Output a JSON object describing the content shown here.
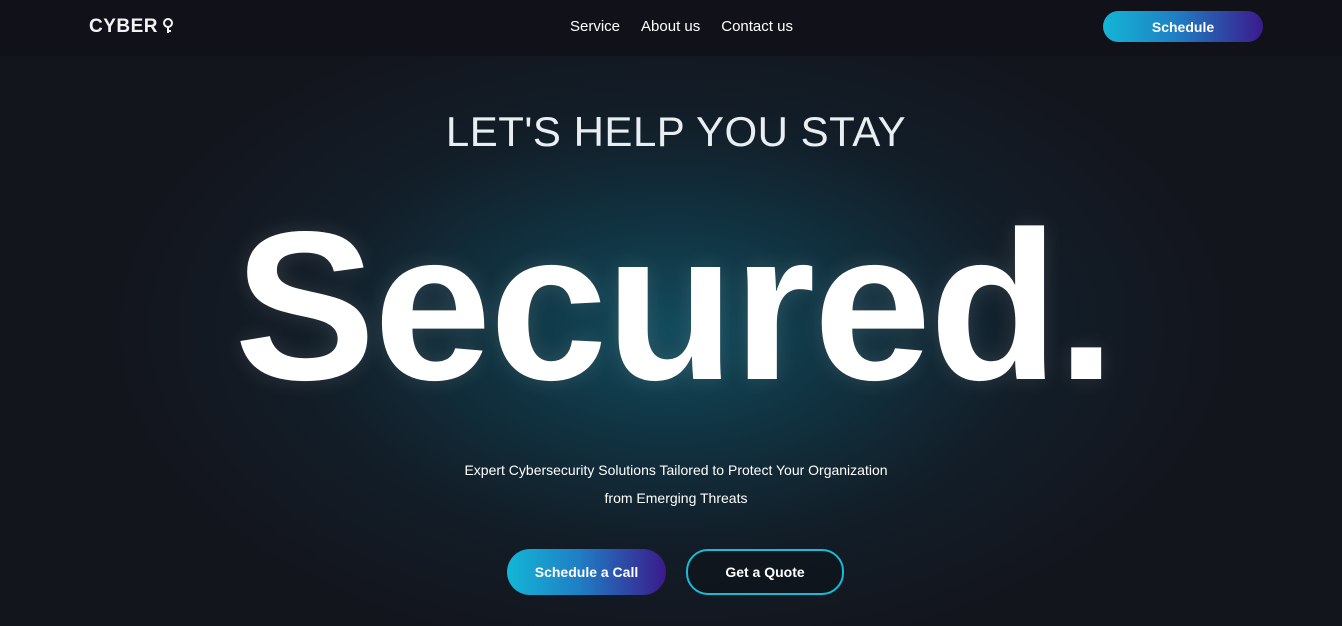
{
  "nav": {
    "logo_text": "CYBER",
    "logo_icon": "keyhole-icon",
    "links": [
      "Service",
      "About us",
      "Contact us"
    ],
    "cta_label": "Schedule"
  },
  "hero": {
    "kicker": "LET'S HELP YOU STAY",
    "title": "Secured.",
    "subtitle_line1": "Expert Cybersecurity Solutions Tailored to Protect Your Organization",
    "subtitle_line2": "from Emerging Threats",
    "primary_button": "Schedule a Call",
    "secondary_button": "Get a Quote"
  },
  "colors": {
    "background": "#13151d",
    "accent_start": "#13b6d6",
    "accent_end": "#3b1a8c",
    "outline": "#18bcd6",
    "text": "#ffffff"
  }
}
